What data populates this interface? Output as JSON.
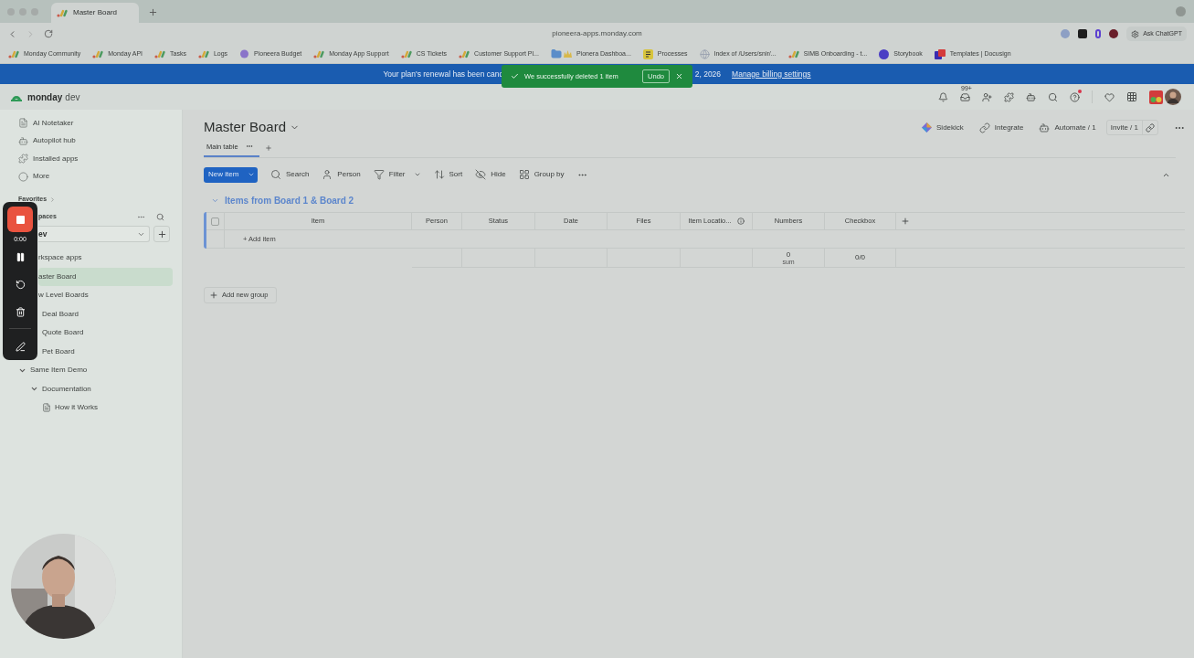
{
  "browser": {
    "tab_title": "Master Board",
    "url": "pioneera-apps.monday.com",
    "ask_chatgpt": "Ask ChatGPT",
    "bookmarks": [
      {
        "label": "Monday Community",
        "kind": "monday"
      },
      {
        "label": "Monday API",
        "kind": "monday"
      },
      {
        "label": "Tasks",
        "kind": "monday"
      },
      {
        "label": "Logs",
        "kind": "monday"
      },
      {
        "label": "Pioneera Budget",
        "kind": "brain"
      },
      {
        "label": "Monday App Support",
        "kind": "monday"
      },
      {
        "label": "CS Tickets",
        "kind": "monday"
      },
      {
        "label": "Customer Support Pl...",
        "kind": "monday"
      },
      {
        "label": "Pionera Dashboa...",
        "kind": "folder"
      },
      {
        "label": "Processes",
        "kind": "note"
      },
      {
        "label": "Index of /Users/snir/...",
        "kind": "globe"
      },
      {
        "label": "SIMB Onboarding - t...",
        "kind": "monday"
      },
      {
        "label": "Storybook",
        "kind": "storybook"
      },
      {
        "label": "Templates | Docusign",
        "kind": "docusign"
      }
    ]
  },
  "banner": {
    "text_start": "Your plan's renewal has been canc",
    "text_end": "2, 2026",
    "link": "Manage billing settings"
  },
  "toast": {
    "message": "We successfully deleted 1 item",
    "undo": "Undo"
  },
  "app": {
    "logo": "monday",
    "logo_suffix": "dev",
    "inbox_badge": "99+"
  },
  "sidebar": {
    "items": [
      {
        "label": "AI Notetaker",
        "kind": "notetaker"
      },
      {
        "label": "Autopilot hub",
        "kind": "robot"
      },
      {
        "label": "Installed apps",
        "kind": "puzzle"
      },
      {
        "label": "More",
        "kind": "more"
      }
    ],
    "favorites": "Favorites",
    "workspaces": "paces",
    "workspace_select": "ev",
    "tree": [
      {
        "label": "rkspace apps",
        "selected": false
      },
      {
        "label": "aster Board",
        "selected": true
      },
      {
        "label": "w Level Boards",
        "selected": false,
        "children": [
          {
            "label": "Deal Board",
            "selected": false
          },
          {
            "label": "Quote Board",
            "selected": false
          },
          {
            "label": "Pet Board",
            "selected": false
          }
        ]
      },
      {
        "label": "Same Item Demo",
        "selected": false,
        "expanded": true,
        "children": [
          {
            "label": "Documentation",
            "selected": false,
            "expanded": true,
            "children": [
              {
                "label": "How it Works",
                "kind": "doc",
                "selected": false
              }
            ]
          }
        ]
      }
    ]
  },
  "board": {
    "title": "Master Board",
    "actions": [
      {
        "label": "Sidekick",
        "kind": "sidekick"
      },
      {
        "label": "Integrate",
        "kind": "integrate"
      },
      {
        "label": "Automate / 1",
        "kind": "automate"
      }
    ],
    "invite": "Invite / 1",
    "views": [
      {
        "label": "Main table",
        "selected": true
      }
    ],
    "new_item": "New item",
    "toolbar": [
      {
        "label": "Search",
        "kind": "search"
      },
      {
        "label": "Person",
        "kind": "person"
      },
      {
        "label": "Filter",
        "kind": "filter"
      },
      {
        "label": "Sort",
        "kind": "sort"
      },
      {
        "label": "Hide",
        "kind": "hide"
      },
      {
        "label": "Group by",
        "kind": "group"
      }
    ],
    "group": {
      "title": "Items from Board 1 & Board 2",
      "columns": [
        "Item",
        "Person",
        "Status",
        "Date",
        "Files",
        "Item Locatio...",
        "Numbers",
        "Checkbox"
      ],
      "select_all": {
        "checked": false
      },
      "add_item": "+ Add item",
      "summary": {
        "numbers": "0",
        "numbers_caption": "sum",
        "checkbox": "0/0"
      }
    },
    "add_group": "Add new group"
  },
  "recorder": {
    "time": "0:00"
  }
}
